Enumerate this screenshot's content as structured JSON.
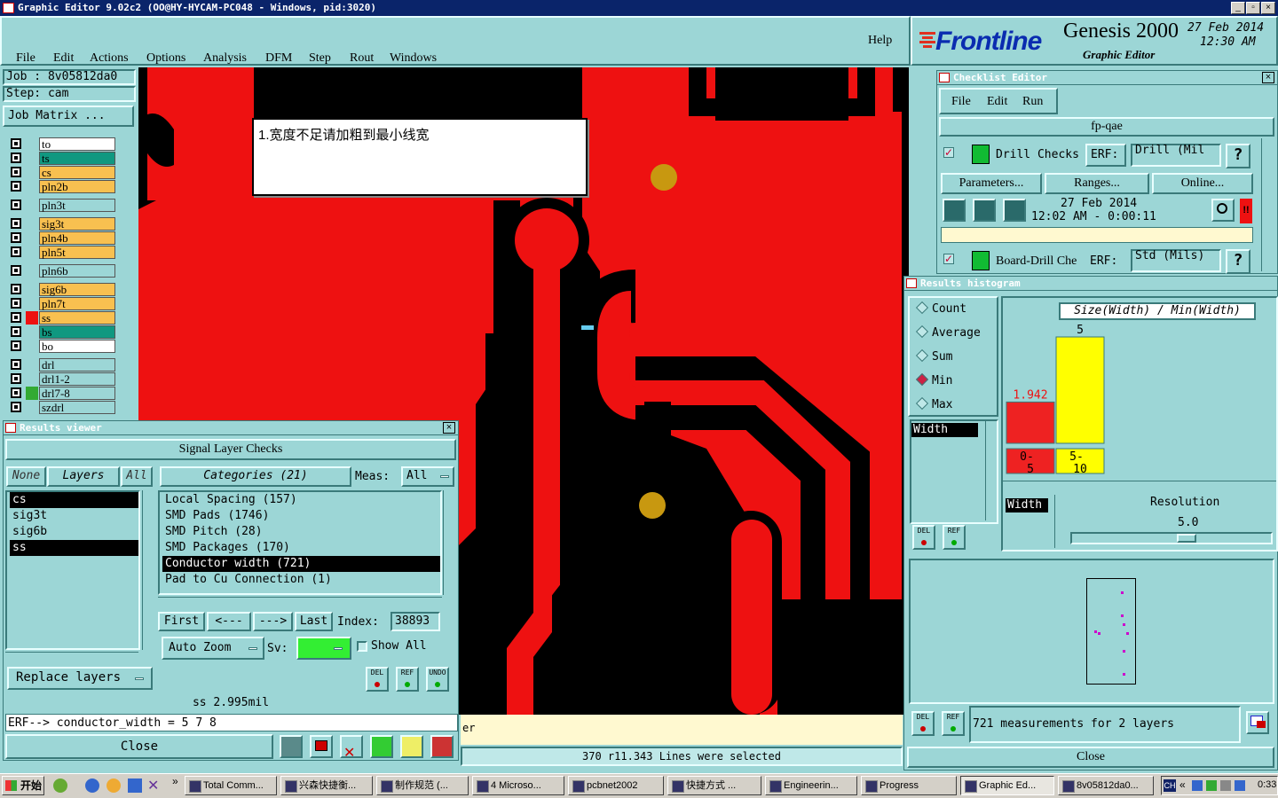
{
  "window": {
    "title": "Graphic Editor 9.02c2 (OO@HY-HYCAM-PC048 - Windows, pid:3020)"
  },
  "menu": [
    "File",
    "Edit",
    "Actions",
    "Options",
    "Analysis",
    "DFM",
    "Step",
    "Rout",
    "Windows"
  ],
  "help": "Help",
  "brand": {
    "logo": "Frontline",
    "product": "Genesis 2000",
    "subtitle": "Graphic Editor",
    "date": "27 Feb 2014",
    "time": "12:30 AM"
  },
  "job": {
    "job_label": "Job : 8v05812da0",
    "step_label": "Step: cam",
    "matrix_button": "Job Matrix ..."
  },
  "layers": [
    {
      "name": "to",
      "color": "#ffffff"
    },
    {
      "name": "ts",
      "color": "#109880"
    },
    {
      "name": "cs",
      "color": "#f8c050"
    },
    {
      "name": "pln2b",
      "color": "#f8c050"
    },
    {
      "name": "pln3t",
      "color": "#9cd6d6"
    },
    {
      "name": "sig3t",
      "color": "#f8c050"
    },
    {
      "name": "pln4b",
      "color": "#f8c050"
    },
    {
      "name": "pln5t",
      "color": "#f8c050"
    },
    {
      "name": "pln6b",
      "color": "#9cd6d6"
    },
    {
      "name": "sig6b",
      "color": "#f8c050"
    },
    {
      "name": "pln7t",
      "color": "#f8c050"
    },
    {
      "name": "ss",
      "color": "#f8c050"
    },
    {
      "name": "bs",
      "color": "#109880"
    },
    {
      "name": "bo",
      "color": "#ffffff"
    },
    {
      "name": "drl",
      "color": "#9cd6d6"
    },
    {
      "name": "drl1-2",
      "color": "#9cd6d6"
    },
    {
      "name": "drl7-8",
      "color": "#9cd6d6"
    },
    {
      "name": "szdrl",
      "color": "#9cd6d6"
    }
  ],
  "annotation": "1.宽度不足请加粗到最小线宽",
  "results_viewer": {
    "title": "Results viewer",
    "header": "Signal Layer Checks",
    "none_btn": "None",
    "layers_btn": "Layers",
    "all_btn": "All",
    "categories_btn": "Categories (21)",
    "meas_label": "Meas:",
    "meas_value": "All",
    "layer_list": [
      "cs",
      "sig3t",
      "sig6b",
      "ss"
    ],
    "categories": [
      "Local Spacing (157)",
      "SMD Pads (1746)",
      "SMD Pitch (28)",
      "SMD Packages (170)",
      "Conductor width (721)",
      "Pad to Cu Connection (1)"
    ],
    "first": "First",
    "prev": "<---",
    "next": "--->",
    "last": "Last",
    "index_label": "Index:",
    "index_value": "38893",
    "auto_zoom": "Auto Zoom",
    "sv_label": "Sv:",
    "show_all": "Show All",
    "replace_layers": "Replace layers",
    "del": "DEL",
    "ref": "REF",
    "undo": "UNDO",
    "status": "ss 2.995mil",
    "erf": "ERF--> conductor_width = 5 7 8",
    "close": "Close"
  },
  "status_bar": {
    "left_fragment": "er",
    "selection": "370 r11.343 Lines were selected"
  },
  "checklist": {
    "title": "Checklist Editor",
    "menu": [
      "File",
      "Edit",
      "Run"
    ],
    "name": "fp-qae",
    "drill_checks": "Drill Checks",
    "erf_label": "ERF:",
    "erf_value": "Drill (Mil",
    "q": "?",
    "parameters": "Parameters...",
    "ranges": "Ranges...",
    "online": "Online...",
    "date": "27 Feb 2014",
    "time": "12:02 AM - 0:00:11",
    "board_drill": "Board-Drill Che",
    "erf2_value": "Std (Mils)"
  },
  "histogram": {
    "title": "Results histogram",
    "options": [
      "Count",
      "Average",
      "Sum",
      "Min",
      "Max"
    ],
    "selected": "Min",
    "width_field": "Width",
    "width_field2": "Width",
    "chart_title": "Size(Width) / Min(Width)",
    "bins": [
      {
        "label_top": "0-",
        "label_bot": "5",
        "value": 1.942,
        "value_label": "1.942",
        "color": "#ee2222"
      },
      {
        "label_top": "5-",
        "label_bot": "10",
        "value": 5,
        "value_label": "5",
        "color": "#ffff00"
      }
    ],
    "resolution_label": "Resolution",
    "resolution_value": "5.0",
    "del": "DEL",
    "ref": "REF",
    "summary": "721 measurements for 2 layers",
    "close": "Close"
  },
  "taskbar": {
    "start": "开始",
    "tasks": [
      "Total Comm...",
      "兴森快捷衡...",
      "制作规范 (...",
      "4 Microso...",
      "pcbnet2002",
      "快捷方式 ...",
      "Engineerin...",
      "Progress",
      "Graphic Ed...",
      "8v05812da0..."
    ],
    "tray_lang": "CH",
    "clock": "0:33"
  }
}
